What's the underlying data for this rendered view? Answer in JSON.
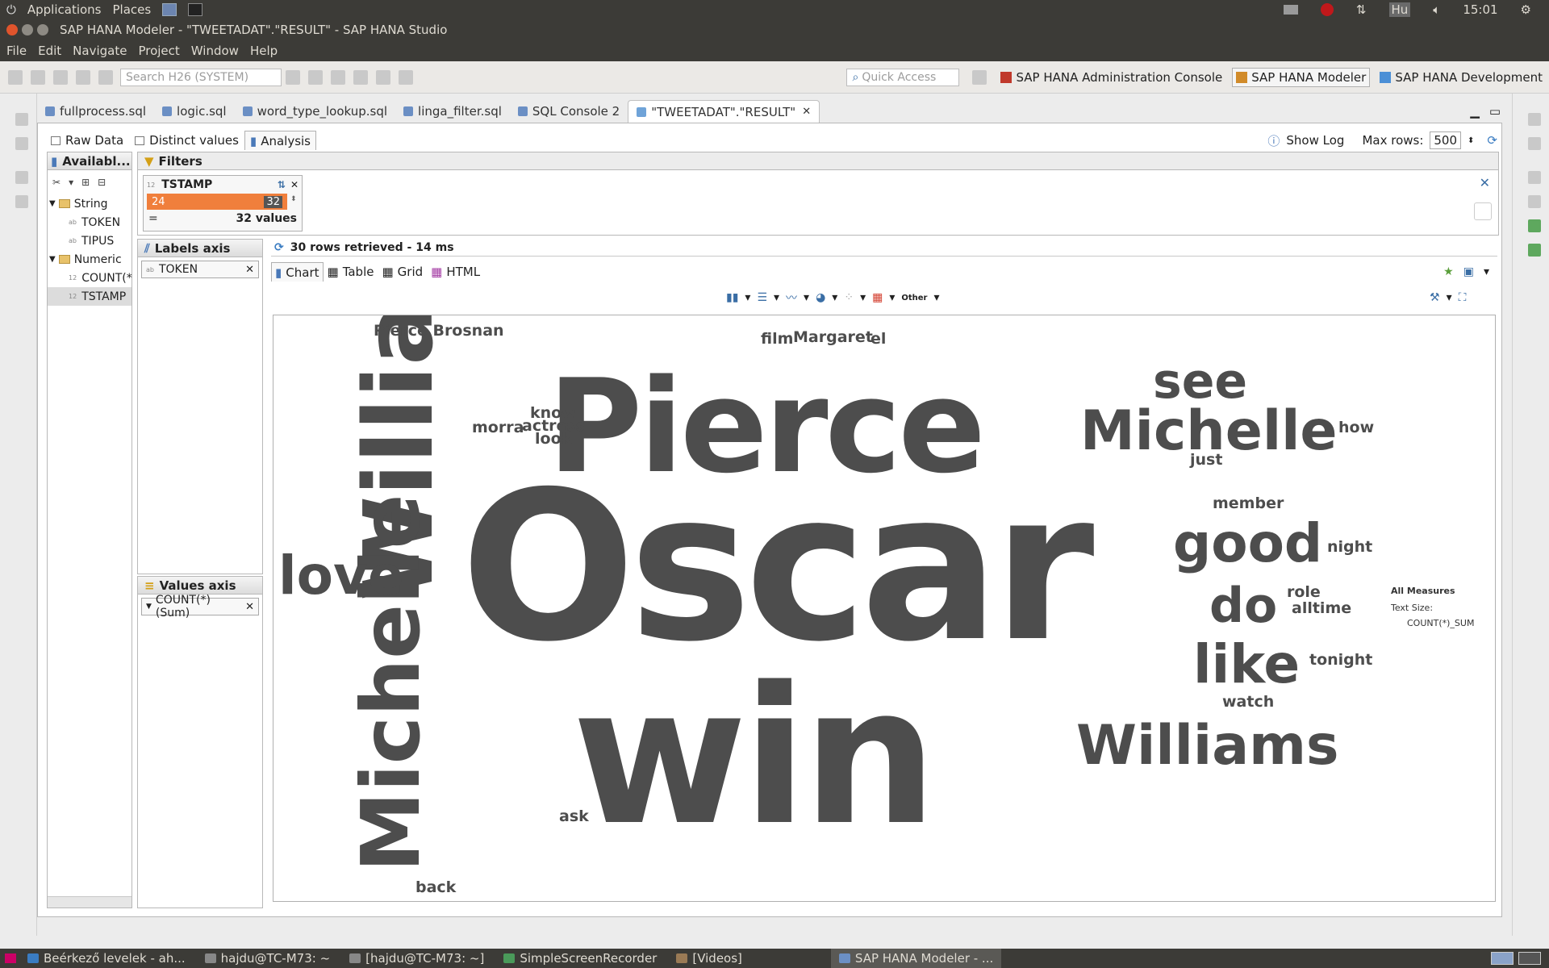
{
  "system_bar": {
    "applications": "Applications",
    "places": "Places",
    "lang": "Hu",
    "clock": "15:01"
  },
  "window": {
    "title": "SAP HANA Modeler - \"TWEETADAT\".\"RESULT\" - SAP HANA Studio"
  },
  "menu": [
    "File",
    "Edit",
    "Navigate",
    "Project",
    "Window",
    "Help"
  ],
  "toolbar": {
    "search_placeholder": "Search H26 (SYSTEM)",
    "quick_access_placeholder": "Quick Access",
    "perspectives": [
      "SAP HANA Administration Console",
      "SAP HANA Modeler",
      "SAP HANA Development"
    ]
  },
  "editor_tabs": [
    "fullprocess.sql",
    "logic.sql",
    "word_type_lookup.sql",
    "linga_filter.sql",
    "SQL Console 2",
    "\"TWEETADAT\".\"RESULT\""
  ],
  "sub_tabs": [
    "Raw Data",
    "Distinct values",
    "Analysis"
  ],
  "right_controls": {
    "show_log": "Show Log",
    "max_rows_label": "Max rows:",
    "max_rows_value": "500"
  },
  "available": {
    "header": "Availabl...",
    "groups": [
      {
        "name": "String",
        "items": [
          "TOKEN",
          "TIPUS"
        ]
      },
      {
        "name": "Numeric",
        "items": [
          "COUNT(*",
          "TSTAMP"
        ]
      }
    ]
  },
  "filters": {
    "header": "Filters",
    "filter_name": "TSTAMP",
    "range_min": "24",
    "range_max": "32",
    "operator": "=",
    "count_text": "32 values"
  },
  "labels_axis": {
    "header": "Labels axis",
    "field": "TOKEN"
  },
  "values_axis": {
    "header": "Values axis",
    "field": "COUNT(*) (Sum)"
  },
  "result_status": "30 rows retrieved - 14 ms",
  "view_tabs": [
    "Chart",
    "Table",
    "Grid",
    "HTML"
  ],
  "chart_toolbar": {
    "other_label": "Other"
  },
  "legend": {
    "title": "All Measures",
    "text_size_label": "Text Size:",
    "measure": "COUNT(*)_SUM"
  },
  "chart_data": {
    "type": "word_cloud",
    "words": [
      {
        "text": "Oscar",
        "size": 255
      },
      {
        "text": "win",
        "size": 235
      },
      {
        "text": "Pierce",
        "size": 160
      },
      {
        "text": "Williams",
        "size": 118,
        "rotated": true
      },
      {
        "text": "Michelle",
        "size": 100,
        "rotated": true
      },
      {
        "text": "Michelle",
        "size": 68
      },
      {
        "text": "Williams",
        "size": 68
      },
      {
        "text": "good",
        "size": 66
      },
      {
        "text": "love",
        "size": 66
      },
      {
        "text": "like",
        "size": 66
      },
      {
        "text": "see",
        "size": 60
      },
      {
        "text": "do",
        "size": 60
      },
      {
        "text": "Pierce Brosnan",
        "size": 19
      },
      {
        "text": "Margaret",
        "size": 19
      },
      {
        "text": "film",
        "size": 19
      },
      {
        "text": "el",
        "size": 19
      },
      {
        "text": "morra",
        "size": 19
      },
      {
        "text": "know",
        "size": 19
      },
      {
        "text": "actress",
        "size": 19
      },
      {
        "text": "look",
        "size": 19
      },
      {
        "text": "how",
        "size": 19
      },
      {
        "text": "just",
        "size": 19
      },
      {
        "text": "member",
        "size": 19
      },
      {
        "text": "night",
        "size": 19
      },
      {
        "text": "role",
        "size": 19
      },
      {
        "text": "alltime",
        "size": 19
      },
      {
        "text": "tonight",
        "size": 19
      },
      {
        "text": "watch",
        "size": 19
      },
      {
        "text": "ask",
        "size": 19
      },
      {
        "text": "back",
        "size": 19
      }
    ]
  },
  "taskbar": [
    "Beérkező levelek - ah...",
    "hajdu@TC-M73: ~",
    "[hajdu@TC-M73: ~]",
    "SimpleScreenRecorder",
    "[Videos]",
    "SAP HANA Modeler - ..."
  ]
}
